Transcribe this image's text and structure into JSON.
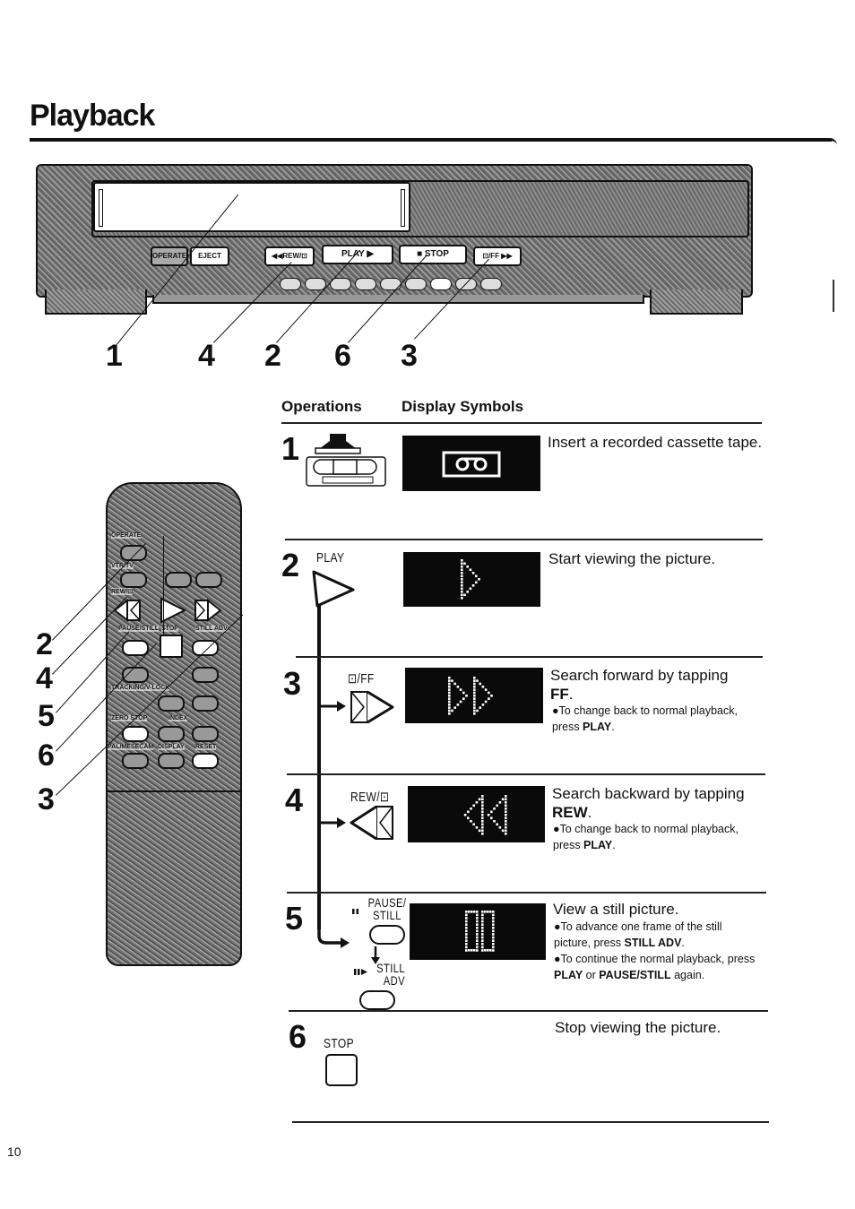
{
  "page": {
    "title": "Playback",
    "page_number": "10"
  },
  "vcr_front": {
    "buttons": {
      "operate": "OPERATE",
      "eject": "EJECT",
      "rew": "◀◀REW/⊡",
      "play": "PLAY ▶",
      "stop": "■ STOP",
      "ff": "⊡/FF ▶▶"
    },
    "callouts": [
      "1",
      "4",
      "2",
      "6",
      "3"
    ]
  },
  "remote": {
    "labels": {
      "operate": "OPERATE",
      "vtr_tv": "VTR/TV",
      "rew": "REW/⊡",
      "pause_still": "PAUSE/STILL",
      "stop": "STOP",
      "still_adv": "STILL ADV",
      "tracking": "TRACKING/V-LOCK",
      "zero_stop": "ZERO STOP",
      "index": "INDEX",
      "pal": "PAL/MESECAM",
      "display": "DISPLAY",
      "reset": "RESET"
    },
    "callouts": [
      "2",
      "4",
      "5",
      "6",
      "3"
    ]
  },
  "table": {
    "headers": {
      "operations": "Operations",
      "display_symbols": "Display Symbols"
    },
    "steps": [
      {
        "number": "1",
        "operation_icon": "cassette-insert-icon",
        "display_icon": "cassette-display-icon",
        "description": "Insert a recorded cassette tape."
      },
      {
        "number": "2",
        "operation_label": "PLAY",
        "operation_icon": "play-button-icon",
        "display_icon": "play-display-icon",
        "description": "Start viewing the picture."
      },
      {
        "number": "3",
        "operation_label": "⊡/FF",
        "operation_icon": "ff-button-icon",
        "display_icon": "ff-display-icon",
        "description_pre": "Search forward by tapping",
        "description_bold": "FF",
        "notes": [
          {
            "pre": "●To change back to normal playback, press ",
            "bold": "PLAY",
            "post": "."
          }
        ]
      },
      {
        "number": "4",
        "operation_label": "REW/⊡",
        "operation_icon": "rew-button-icon",
        "display_icon": "rew-display-icon",
        "description_pre": "Search backward by tapping",
        "description_bold": "REW",
        "notes": [
          {
            "pre": "●To change back to normal playback, press ",
            "bold": "PLAY",
            "post": "."
          }
        ]
      },
      {
        "number": "5",
        "operation_label": "PAUSE/ STILL",
        "operation_label_2": "STILL ADV",
        "operation_icon": "pause-still-button-icon",
        "display_icon": "still-display-icon",
        "description": "View a still picture.",
        "notes": [
          {
            "pre": "●To advance one frame of the still picture, press ",
            "bold": "STILL ADV",
            "post": "."
          },
          {
            "pre": "●To continue the normal playback, press ",
            "bold": "PLAY",
            "mid": " or ",
            "bold2": "PAUSE/STILL",
            "post": " again."
          }
        ]
      },
      {
        "number": "6",
        "operation_label": "STOP",
        "operation_icon": "stop-button-icon",
        "description": "Stop viewing the picture."
      }
    ]
  }
}
